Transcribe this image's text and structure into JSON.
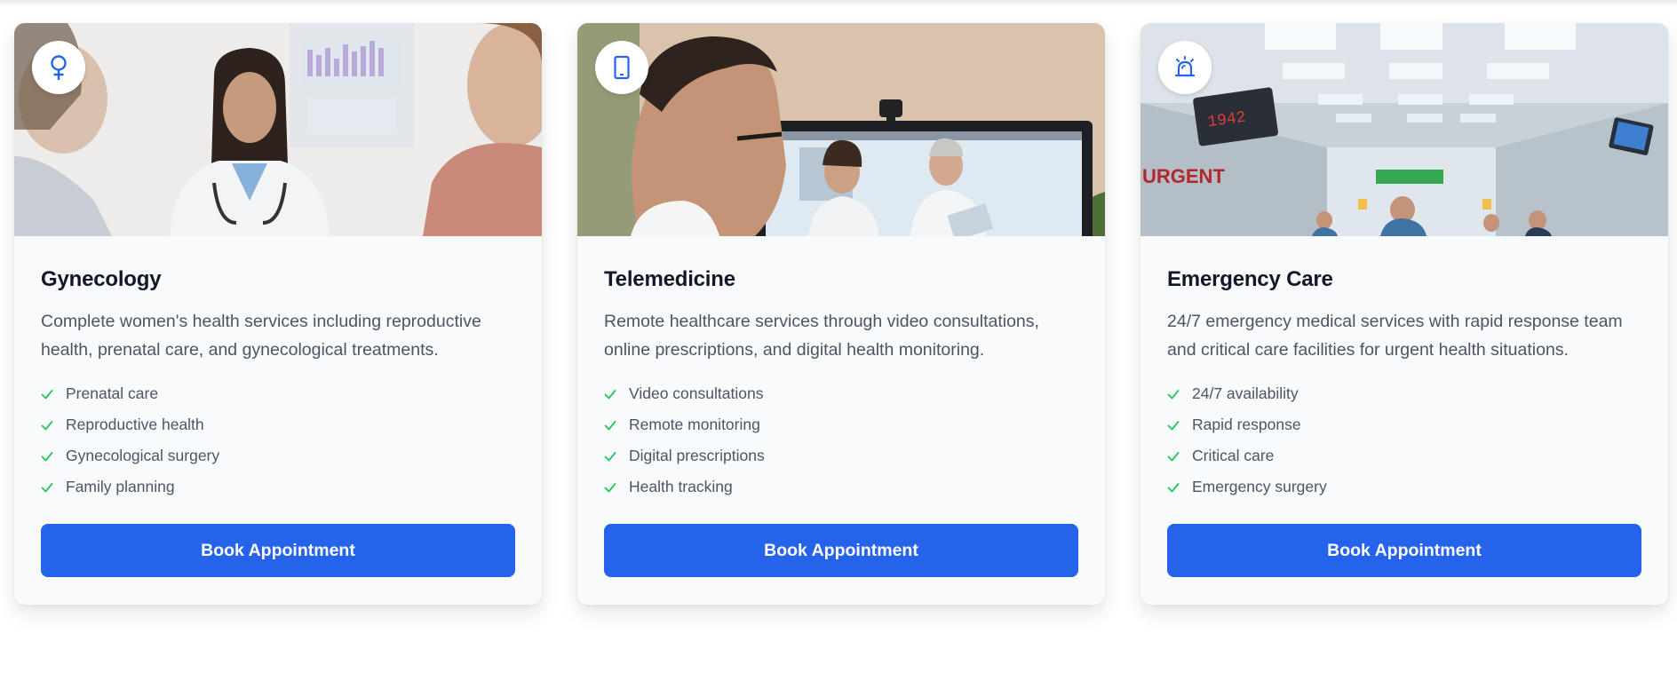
{
  "colors": {
    "accent": "#2563eb",
    "check": "#22c55e",
    "title": "#111827",
    "text": "#4b5563",
    "card_bg": "#f8fafc"
  },
  "services": [
    {
      "icon": "female-symbol-icon",
      "image": "doctor-consultation-photo",
      "title": "Gynecology",
      "description": "Complete women's health services including reproductive health, prenatal care, and gynecological treatments.",
      "features": [
        "Prenatal care",
        "Reproductive health",
        "Gynecological surgery",
        "Family planning"
      ],
      "button_label": "Book Appointment"
    },
    {
      "icon": "tablet-icon",
      "image": "video-call-photo",
      "title": "Telemedicine",
      "description": "Remote healthcare services through video consultations, online prescriptions, and digital health monitoring.",
      "features": [
        "Video consultations",
        "Remote monitoring",
        "Digital prescriptions",
        "Health tracking"
      ],
      "button_label": "Book Appointment"
    },
    {
      "icon": "alarm-siren-icon",
      "image": "emergency-room-photo",
      "title": "Emergency Care",
      "description": "24/7 emergency medical services with rapid response team and critical care facilities for urgent health situations.",
      "features": [
        "24/7 availability",
        "Rapid response",
        "Critical care",
        "Emergency surgery"
      ],
      "button_label": "Book Appointment"
    }
  ]
}
